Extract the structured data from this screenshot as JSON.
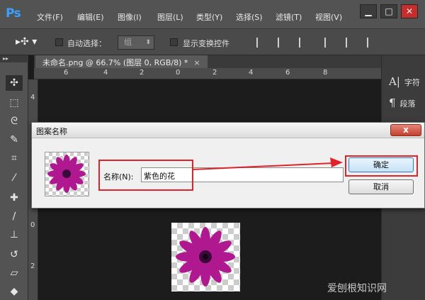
{
  "app": {
    "logo": "Ps"
  },
  "menu": [
    "文件(F)",
    "编辑(E)",
    "图像(I)",
    "图层(L)",
    "类型(Y)",
    "选择(S)",
    "滤镜(T)",
    "视图(V)"
  ],
  "window_controls": {
    "minimize": "▁",
    "maximize": "□",
    "close": "✕"
  },
  "options": {
    "auto_select_label": "自动选择：",
    "auto_select_value": "组",
    "show_transform_label": "显示变换控件"
  },
  "document_tab": {
    "label": "未命名.png @ 66.7% (图层 0, RGB/8) *",
    "close": "×"
  },
  "ruler": {
    "top": [
      "6",
      "4",
      "2",
      "0",
      "2",
      "4",
      "6",
      "8"
    ],
    "left": [
      "4",
      "2",
      "0",
      "2"
    ]
  },
  "right_panel": {
    "items": [
      {
        "icon": "A|",
        "label": "字符"
      },
      {
        "icon": "¶",
        "label": "段落"
      }
    ]
  },
  "dialog": {
    "title": "图案名称",
    "close": "x",
    "name_label": "名称(N):",
    "name_value": "紫色的花",
    "ok_label": "确定",
    "cancel_label": "取消"
  },
  "colors": {
    "annotation": "#e0232a",
    "flower": "#b0188f",
    "flower_center": "#3a0a3a"
  },
  "watermark": "爱刨根知识网"
}
